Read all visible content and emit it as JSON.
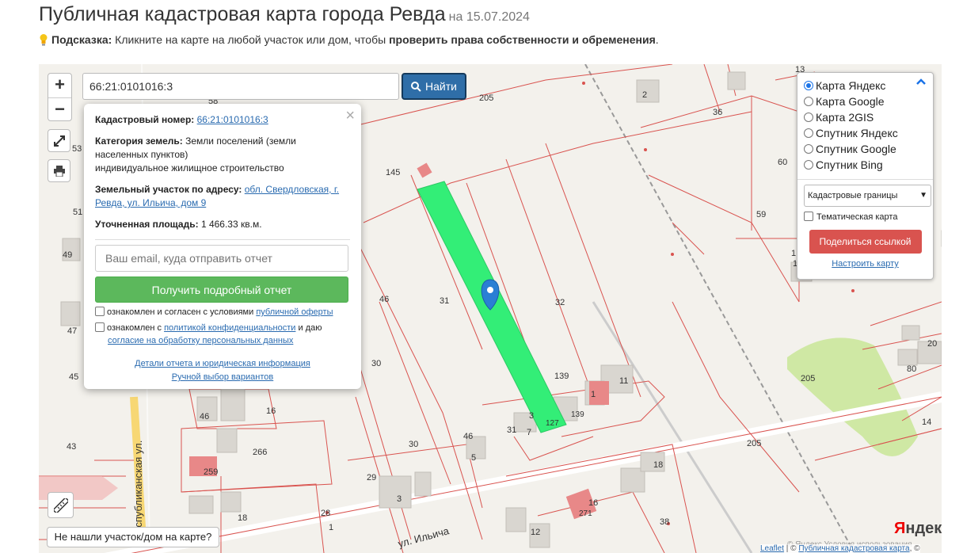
{
  "header": {
    "title": "Публичная кадастровая карта города Ревда",
    "date": "на 15.07.2024"
  },
  "hint": {
    "label": "Подсказка:",
    "text": " Кликните на карте на любой участок или дом, чтобы ",
    "bold_text": "проверить права собственности и обременения",
    "end": "."
  },
  "map": {
    "zoom_in": "+",
    "zoom_out": "−",
    "search_value": "66:21:0101016:3",
    "search_button": "Найти",
    "not_found_button": "Не нашли участок/дом на карте?",
    "yandex_logo_prefix": "Я",
    "yandex_logo_rest": "ндекс",
    "terms_text": "© Яндекс  Условия использования",
    "street_label_1": "Республиканская ул.",
    "street_label_2": "ул. Ильича",
    "parcel_labels": [
      "205",
      "36",
      "2",
      "58",
      "53",
      "51",
      "49",
      "47",
      "45",
      "43",
      "46",
      "145",
      "59",
      "46",
      "31",
      "32",
      "30",
      "139",
      "11",
      "1",
      "3",
      "7",
      "31",
      "127",
      "139",
      "46",
      "5",
      "30",
      "29",
      "3",
      "16",
      "266",
      "259",
      "28",
      "1",
      "18",
      "12",
      "16",
      "38",
      "18",
      "205",
      "205",
      "20",
      "80",
      "1",
      "60",
      "13",
      "1",
      "271",
      "14"
    ]
  },
  "popup": {
    "cad_label": "Кадастровый номер:",
    "cad_value": "66:21:0101016:3",
    "cat_label": "Категория земель:",
    "cat_value": "Земли поселений (земли населенных пунктов)",
    "use_value": "индивидуальное жилищное строительство",
    "addr_label": "Земельный участок по адресу:",
    "addr_value": "обл. Свердловская, г. Ревда, ул. Ильича, дом 9",
    "area_label": "Уточненная площадь:",
    "area_value": "1 466.33 кв.м.",
    "email_placeholder": "Ваш email, куда отправить отчет",
    "report_button": "Получить подробный отчет",
    "agree1_text": "ознакомлен и согласен с условиями ",
    "agree1_link": "публичной оферты",
    "agree2_text": "ознакомлен с ",
    "agree2_link": "политикой конфиденциальности",
    "agree2_mid": " и даю",
    "agree2_link2": "согласие на обработку персональных данных",
    "details_link": "Детали отчета и юридическая информация",
    "manual_link": "Ручной выбор вариантов",
    "close": "×"
  },
  "layers": {
    "options": [
      {
        "label": "Карта Яндекс",
        "selected": true
      },
      {
        "label": "Карта Google",
        "selected": false
      },
      {
        "label": "Карта 2GIS",
        "selected": false
      },
      {
        "label": "Спутник Яндекс",
        "selected": false
      },
      {
        "label": "Спутник Google",
        "selected": false
      },
      {
        "label": "Спутник Bing",
        "selected": false
      }
    ],
    "overlay_select": "Кадастровые границы",
    "thematic_label": "Тематическая карта",
    "share_button": "Поделиться ссылкой",
    "setup_link": "Настроить карту"
  },
  "attribution": {
    "leaflet": "Leaflet",
    "sep": " | © ",
    "source": "Публичная кадастровая карта",
    "end": ", ©"
  },
  "colors": {
    "parcel_line": "#d9534f",
    "selected_parcel": "#33ee77",
    "search_btn": "#2f6ea8",
    "report_btn": "#5cb85c",
    "share_btn": "#d9534f",
    "marker": "#2a7fd4"
  }
}
